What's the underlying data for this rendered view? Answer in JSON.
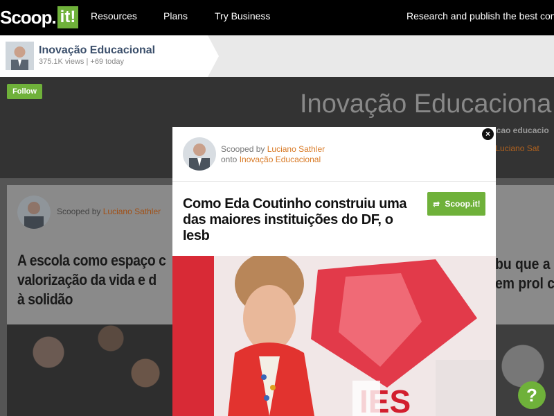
{
  "topnav": {
    "logo_text": "Scoop.",
    "logo_badge": "it!",
    "links": [
      "Resources",
      "Plans",
      "Try Business"
    ],
    "tagline": "Research and publish the best cont"
  },
  "subbar": {
    "title": "Inovação Educacional",
    "meta": "375.1K views | +69 today"
  },
  "hero": {
    "follow_label": "Follow",
    "title": "Inovação Educaciona",
    "subtitle": "acao educacio",
    "by_prefix": "y",
    "by_author": "Luciano Sat"
  },
  "card": {
    "scooped_prefix": "Scooped by",
    "scooped_author": "Luciano Sathler",
    "title_lines": [
      "A escola como espaço c",
      "valorização da vida e d",
      "à solidão"
    ],
    "right_lines": [
      "bu que a",
      "em prol c"
    ]
  },
  "modal": {
    "scooped_prefix": "Scooped by",
    "scooped_author": "Luciano Sathler",
    "onto_prefix": "onto",
    "onto_topic": "Inovação Educacional",
    "title": "Como Eda Coutinho construiu uma das maiores instituições do DF, o Iesb",
    "scoop_button": "Scoop.it!",
    "close_label": "×",
    "image_sign_text": "IES"
  },
  "help_label": "?",
  "colors": {
    "brand_green": "#6fb13a",
    "accent_orange": "#d97b27",
    "title_navy": "#3b4f6b"
  }
}
